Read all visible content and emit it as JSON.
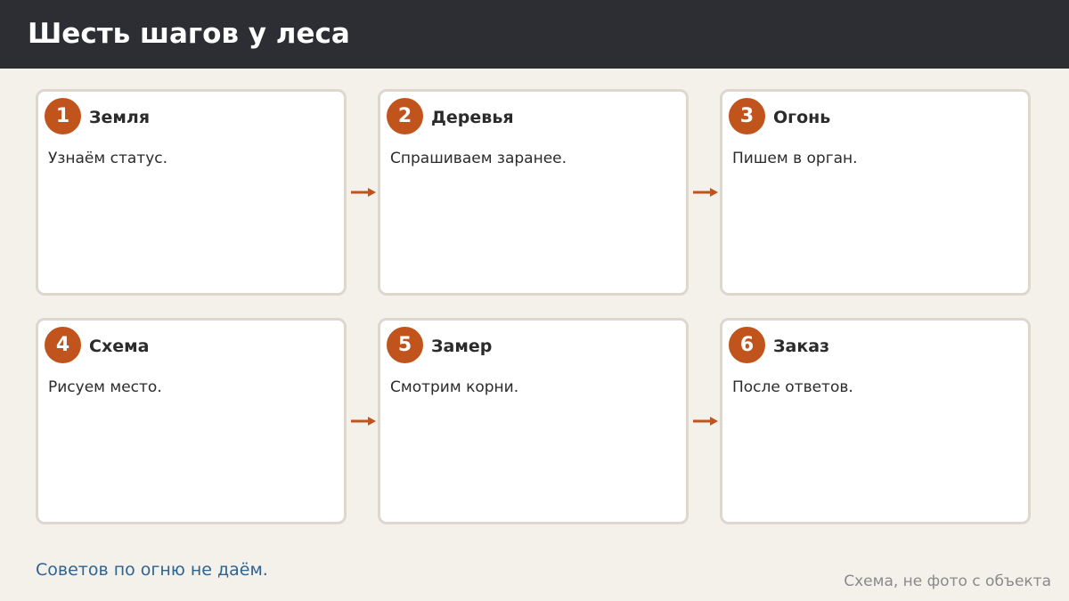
{
  "header": {
    "title": "Шесть шагов у леса"
  },
  "steps": [
    {
      "number": "1",
      "title": "Земля",
      "text": "Узнаём статус."
    },
    {
      "number": "2",
      "title": "Деревья",
      "text": "Спрашиваем заранее."
    },
    {
      "number": "3",
      "title": "Огонь",
      "text": "Пишем в орган."
    },
    {
      "number": "4",
      "title": "Схема",
      "text": "Рисуем место."
    },
    {
      "number": "5",
      "title": "Замер",
      "text": "Смотрим корни."
    },
    {
      "number": "6",
      "title": "Заказ",
      "text": "После ответов."
    }
  ],
  "footer": {
    "note": "Советов по огню не даём.",
    "caption": "Схема, не фото с объекта"
  },
  "colors": {
    "accent": "#c0541c",
    "header_bg": "#2c2e33",
    "note": "#2e6490"
  }
}
